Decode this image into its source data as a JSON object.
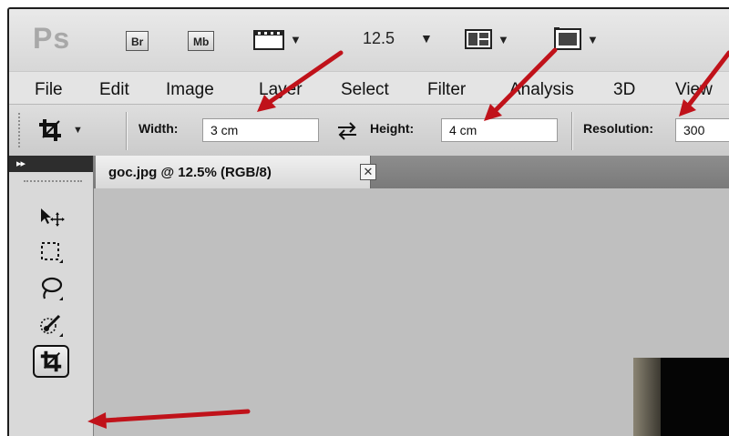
{
  "app": {
    "logo_text": "Ps",
    "bridge_label": "Br",
    "mini_bridge_label": "Mb",
    "zoom_value": "12.5"
  },
  "menu": {
    "items": [
      "File",
      "Edit",
      "Image",
      "Layer",
      "Select",
      "Filter",
      "Analysis",
      "3D",
      "View"
    ]
  },
  "options": {
    "width_label": "Width:",
    "width_value": "3 cm",
    "height_label": "Height:",
    "height_value": "4 cm",
    "resolution_label": "Resolution:",
    "resolution_value": "300"
  },
  "tools": {
    "collapse_glyph": "▸▸",
    "items": [
      "move-tool",
      "marquee-tool",
      "lasso-tool",
      "quick-selection-tool",
      "crop-tool"
    ],
    "active": "crop-tool"
  },
  "document": {
    "tab_title": "goc.jpg @ 12.5% (RGB/8)",
    "close_glyph": "✕"
  },
  "colors": {
    "annotation_arrow": "#c0121a",
    "canvas_bg": "#bfbfbf"
  }
}
